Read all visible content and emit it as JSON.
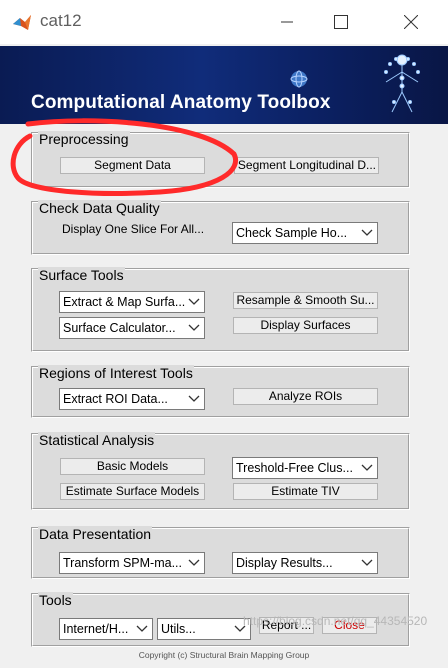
{
  "window": {
    "title": "cat12"
  },
  "banner": {
    "title": "Computational Anatomy Toolbox"
  },
  "panels": {
    "preprocessing": {
      "title": "Preprocessing",
      "segment": "Segment Data",
      "longitudinal": "Segment Longitudinal D..."
    },
    "quality": {
      "title": "Check Data Quality",
      "slice": "Display One Slice For All...",
      "sample": "Check Sample Ho..."
    },
    "surface": {
      "title": "Surface Tools",
      "extract": "Extract & Map Surfa...",
      "resample": "Resample & Smooth Su...",
      "calculator": "Surface Calculator...",
      "display": "Display Surfaces"
    },
    "roi": {
      "title": "Regions of Interest Tools",
      "extract": "Extract ROI Data...",
      "analyze": "Analyze ROIs"
    },
    "stats": {
      "title": "Statistical Analysis",
      "basic": "Basic Models",
      "tfce": "Treshold-Free Clus...",
      "surface_models": "Estimate Surface Models",
      "tiv": "Estimate TIV"
    },
    "presentation": {
      "title": "Data Presentation",
      "transform": "Transform SPM-ma...",
      "results": "Display Results..."
    },
    "tools": {
      "title": "Tools",
      "internet": "Internet/H...",
      "utils": "Utils...",
      "report": "Report ...",
      "close": "Close"
    }
  },
  "footer": {
    "copyright": "Copyright (c) Structural Brain Mapping Group",
    "watermark": "https://blog.csdn.net/qq_44354520"
  },
  "colors": {
    "annotation": "#ff2a2a",
    "close_text": "#cc0000"
  }
}
